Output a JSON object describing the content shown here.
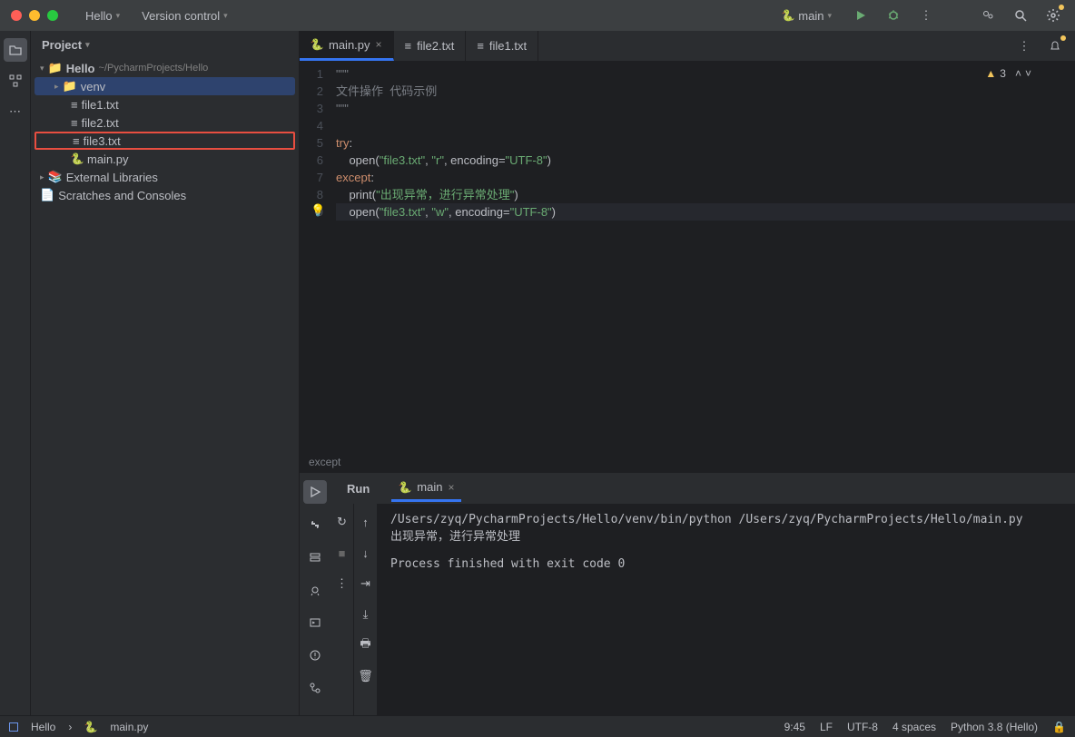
{
  "titlebar": {
    "project": "Hello",
    "vcs": "Version control",
    "run_config": "main"
  },
  "sidebar": {
    "header": "Project",
    "root": "Hello",
    "root_path": "~/PycharmProjects/Hello",
    "items": [
      "venv",
      "file1.txt",
      "file2.txt",
      "file3.txt",
      "main.py"
    ],
    "ext_lib": "External Libraries",
    "scratches": "Scratches and Consoles"
  },
  "tabs": [
    {
      "label": "main.py",
      "active": true,
      "closable": true,
      "type": "py"
    },
    {
      "label": "file2.txt",
      "active": false,
      "closable": false,
      "type": "txt"
    },
    {
      "label": "file1.txt",
      "active": false,
      "closable": false,
      "type": "txt"
    }
  ],
  "editor": {
    "warnings": "3",
    "lines": [
      {
        "n": 1,
        "html": "<span class='cmt'>\"\"\"</span>"
      },
      {
        "n": 2,
        "html": "<span class='cmt'>文件操作  代码示例</span>"
      },
      {
        "n": 3,
        "html": "<span class='cmt'>\"\"\"</span>"
      },
      {
        "n": 4,
        "html": ""
      },
      {
        "n": 5,
        "html": "<span class='kw'>try</span><span class='punc'>:</span>"
      },
      {
        "n": 6,
        "html": "    <span class='fn'>open</span><span class='punc'>(</span><span class='str'>\"file3.txt\"</span><span class='punc'>, </span><span class='str'>\"r\"</span><span class='punc'>, </span><span class='fn'>encoding</span><span class='punc'>=</span><span class='str'>\"UTF-8\"</span><span class='punc'>)</span>"
      },
      {
        "n": 7,
        "html": "<span class='kw'>except</span><span class='punc'>:</span>"
      },
      {
        "n": 8,
        "html": "    <span class='fn'>print</span><span class='punc'>(</span><span class='str'>\"出现异常，进行异常处理\"</span><span class='punc'>)</span>"
      },
      {
        "n": 9,
        "html": "    <span class='fn'>open</span><span class='punc'>(</span><span class='str'>\"file3.txt\"</span><span class='punc'>, </span><span class='str'>\"w\"</span><span class='punc'>, </span><span class='fn'>encoding</span><span class='punc'>=</span><span class='str'>\"UTF-8\"</span><span class='punc'>)</span>",
        "hl": true
      }
    ],
    "breadcrumb": "except"
  },
  "run": {
    "tab_run": "Run",
    "tab_main": "main",
    "output": "/Users/zyq/PycharmProjects/Hello/venv/bin/python /Users/zyq/PycharmProjects/Hello/main.py\n出现异常，进行异常处理\n\nProcess finished with exit code 0"
  },
  "statusbar": {
    "project": "Hello",
    "file": "main.py",
    "pos": "9:45",
    "lf": "LF",
    "enc": "UTF-8",
    "indent": "4 spaces",
    "interp": "Python 3.8 (Hello)"
  }
}
